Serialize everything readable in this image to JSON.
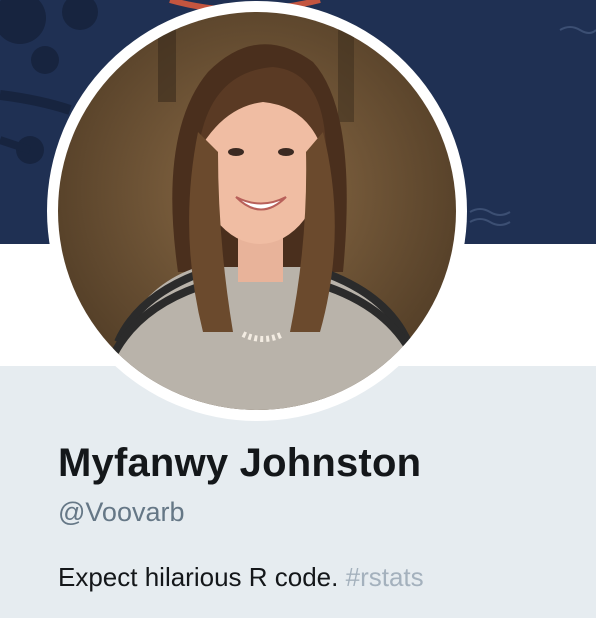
{
  "profile": {
    "display_name": "Myfanwy Johnston",
    "handle": "@Voovarb",
    "bio": {
      "text": "Expect hilarious R code.",
      "hashtag": "#rstats"
    }
  },
  "colors": {
    "banner": "#1f3053",
    "profile_background": "#e6ecf0",
    "name": "#14171a",
    "handle": "#657786",
    "hashtag": "#a4b1bd"
  }
}
